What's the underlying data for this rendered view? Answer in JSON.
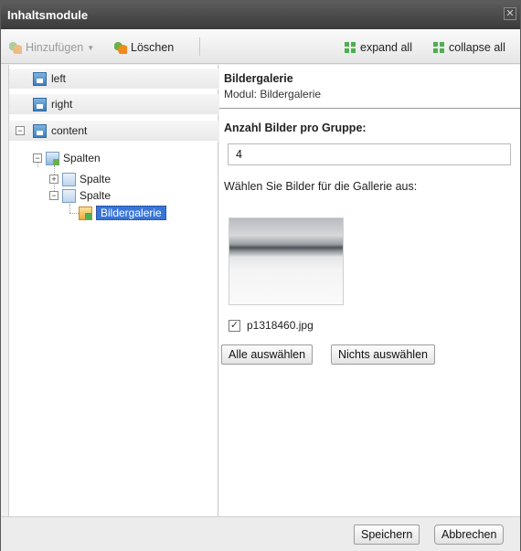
{
  "window": {
    "title": "Inhaltsmodule",
    "close_glyph": "✕"
  },
  "toolbar": {
    "add_label": "Hinzufügen",
    "delete_label": "Löschen",
    "expand_label": "expand all",
    "collapse_label": "collapse all"
  },
  "tree": {
    "regions": [
      {
        "label": "left"
      },
      {
        "label": "right"
      },
      {
        "label": "content"
      }
    ],
    "nodes": {
      "spalten": "Spalten",
      "spalte1": "Spalte",
      "spalte2": "Spalte",
      "gallery": "Bildergalerie"
    },
    "selected": "Bildergalerie"
  },
  "module": {
    "title": "Bildergalerie",
    "subtitle": "Modul: Bildergalerie",
    "group_label": "Anzahl Bilder pro Gruppe:",
    "group_value": "4",
    "select_label": "Wählen Sie Bilder für die Gallerie aus:",
    "images": [
      {
        "filename": "p1318460.jpg",
        "checked": true
      }
    ],
    "select_all_label": "Alle auswählen",
    "select_none_label": "Nichts auswählen"
  },
  "footer": {
    "save_label": "Speichern",
    "cancel_label": "Abbrechen"
  }
}
